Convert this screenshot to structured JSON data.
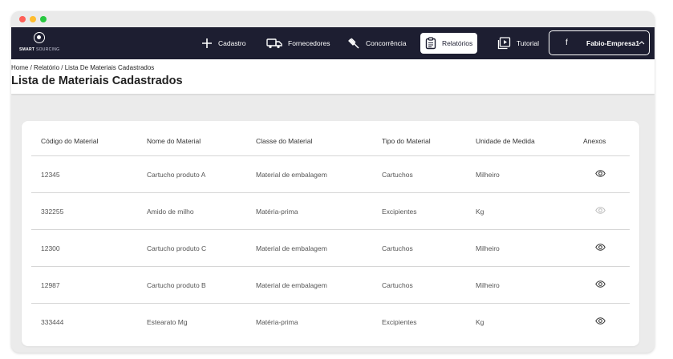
{
  "logo": {
    "brand_bold": "SMART",
    "brand_light": " SOURCING"
  },
  "nav": {
    "items": [
      {
        "label": "Cadastro",
        "icon": "plus-icon"
      },
      {
        "label": "Fornecedores",
        "icon": "truck-icon"
      },
      {
        "label": "Concorrência",
        "icon": "gavel-icon"
      },
      {
        "label": "Relatórios",
        "icon": "clipboard-icon",
        "active": true
      },
      {
        "label": "Tutorial",
        "icon": "play-icon"
      }
    ],
    "user": {
      "initial": "f",
      "name": "Fabio-Empresa1",
      "icon": "chevron-up-icon"
    }
  },
  "breadcrumb": {
    "home": "Home",
    "sep": " / ",
    "relatorio": "Relatório",
    "current": "Lista De Materiais Cadastrados"
  },
  "page_title": "Lista de Materiais Cadastrados",
  "table": {
    "headers": [
      "Código do Material",
      "Nome do Material",
      "Classe do Material",
      "Tipo do Material",
      "Unidade de Medida",
      "Anexos"
    ],
    "rows": [
      {
        "codigo": "12345",
        "nome": "Cartucho produto A",
        "classe": "Material de embalagem",
        "tipo": "Cartuchos",
        "unidade": "Milheiro",
        "anexo_enabled": true
      },
      {
        "codigo": "332255",
        "nome": "Amido de milho",
        "classe": "Matéria-prima",
        "tipo": "Excipientes",
        "unidade": "Kg",
        "anexo_enabled": false
      },
      {
        "codigo": "12300",
        "nome": "Cartucho produto C",
        "classe": "Material de embalagem",
        "tipo": "Cartuchos",
        "unidade": "Milheiro",
        "anexo_enabled": true
      },
      {
        "codigo": "12987",
        "nome": "Cartucho produto B",
        "classe": "Material de embalagem",
        "tipo": "Cartuchos",
        "unidade": "Milheiro",
        "anexo_enabled": true
      },
      {
        "codigo": "333444",
        "nome": "Estearato Mg",
        "classe": "Matéria-prima",
        "tipo": "Excipientes",
        "unidade": "Kg",
        "anexo_enabled": true
      }
    ]
  },
  "colors": {
    "navbar": "#1d1e31",
    "background": "#ebebeb",
    "eye_active": "#333333",
    "eye_disabled": "#bdbdbd"
  }
}
